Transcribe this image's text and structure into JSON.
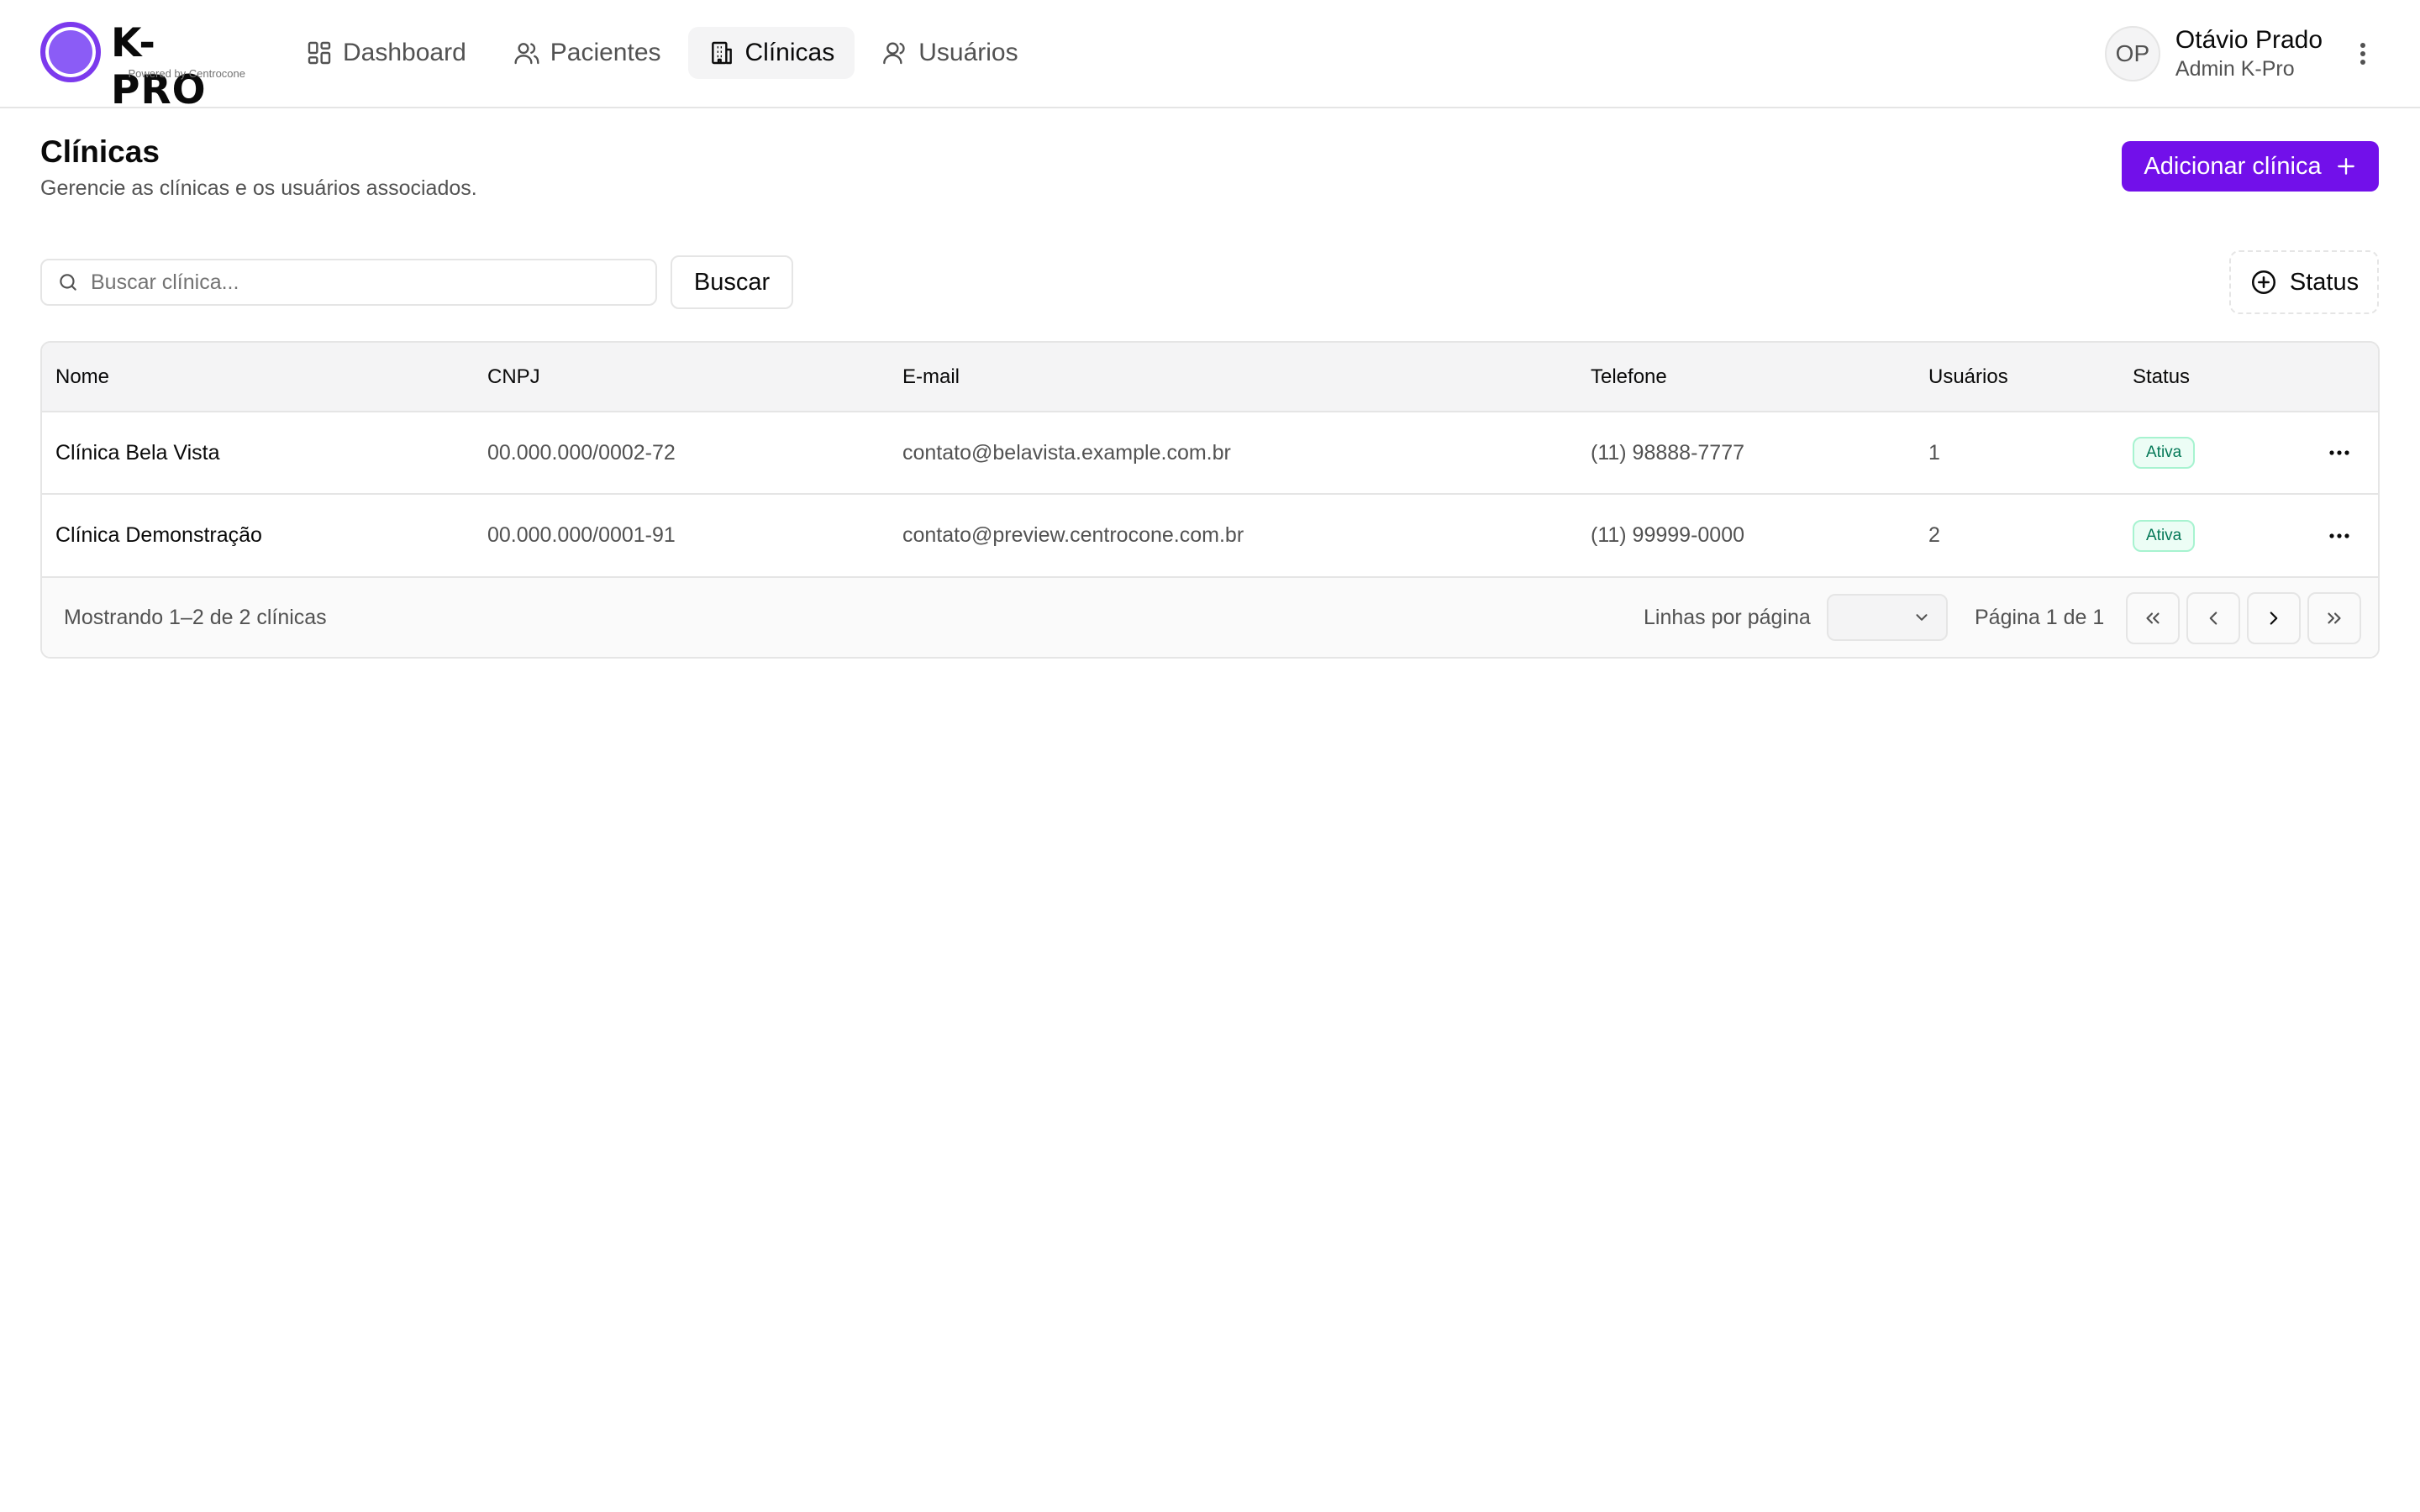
{
  "brand": {
    "name": "K-PRO",
    "tagline": "Powered by Centrocone"
  },
  "nav": {
    "items": [
      {
        "label": "Dashboard",
        "icon": "dashboard-icon"
      },
      {
        "label": "Pacientes",
        "icon": "users-icon"
      },
      {
        "label": "Clínicas",
        "icon": "building-icon",
        "active": true
      },
      {
        "label": "Usuários",
        "icon": "user-group-icon"
      }
    ]
  },
  "user": {
    "initials": "OP",
    "name": "Otávio Prado",
    "role": "Admin K-Pro"
  },
  "page": {
    "title": "Clínicas",
    "subtitle": "Gerencie as clínicas e os usuários associados.",
    "add_button": "Adicionar clínica"
  },
  "toolbar": {
    "search_placeholder": "Buscar clínica...",
    "search_button": "Buscar",
    "status_filter": "Status"
  },
  "table": {
    "columns": [
      "Nome",
      "CNPJ",
      "E-mail",
      "Telefone",
      "Usuários",
      "Status"
    ],
    "rows": [
      {
        "nome": "Clínica Bela Vista",
        "cnpj": "00.000.000/0002-72",
        "email": "contato@belavista.example.com.br",
        "telefone": "(11) 98888-7777",
        "usuarios": "1",
        "status": "Ativa"
      },
      {
        "nome": "Clínica Demonstração",
        "cnpj": "00.000.000/0001-91",
        "email": "contato@preview.centrocone.com.br",
        "telefone": "(11) 99999-0000",
        "usuarios": "2",
        "status": "Ativa"
      }
    ]
  },
  "footer": {
    "count": "Mostrando 1–2 de 2 clínicas",
    "rows_per_page_label": "Linhas por página",
    "rows_per_page_value": "",
    "page_info": "Página 1 de 1"
  },
  "colors": {
    "accent": "#7210ea",
    "status_active_text": "#047857",
    "status_active_bg": "#ecfdf5"
  }
}
